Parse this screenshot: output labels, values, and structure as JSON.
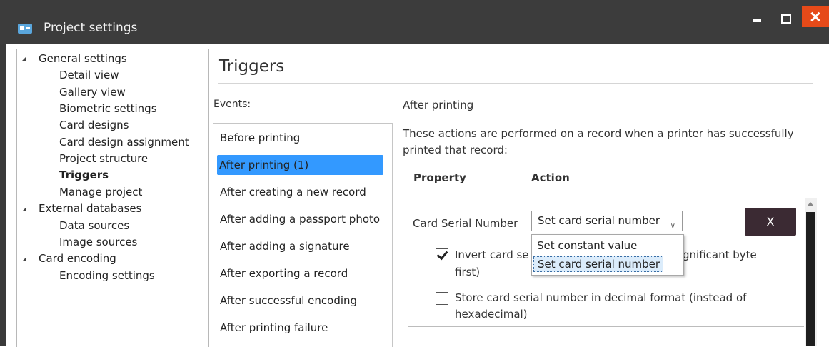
{
  "window": {
    "title": "Project settings"
  },
  "tree": {
    "general": "General settings",
    "detail_view": "Detail view",
    "gallery_view": "Gallery view",
    "biometric": "Biometric settings",
    "card_designs": "Card designs",
    "card_design_assignment": "Card design assignment",
    "project_structure": "Project structure",
    "triggers": "Triggers",
    "manage_project": "Manage project",
    "external_databases": "External databases",
    "data_sources": "Data sources",
    "image_sources": "Image sources",
    "card_encoding": "Card encoding",
    "encoding_settings": "Encoding settings"
  },
  "page": {
    "title": "Triggers"
  },
  "events": {
    "label": "Events:",
    "items": [
      "Before printing",
      "After printing (1)",
      "After creating a new record",
      "After adding a passport photo",
      "After adding a signature",
      "After exporting a record",
      "After successful encoding",
      "After printing failure"
    ],
    "selected_index": 1
  },
  "detail": {
    "heading": "After printing",
    "description": "These actions are performed on a record when a printer has successfully printed that record:",
    "col_property": "Property",
    "col_action": "Action",
    "row_label": "Card Serial Number",
    "select_value": "Set card serial number",
    "remove_label": "X",
    "invert_text_a": "Invert card se",
    "invert_text_b": "gnificant byte",
    "invert_text_c": "first)",
    "invert_checked": true,
    "store_text": "Store card serial number in decimal format (instead of hexadecimal)",
    "store_checked": false
  },
  "dropdown": {
    "options": [
      "Set constant value",
      "Set card serial number"
    ],
    "highlighted_index": 1
  },
  "colors": {
    "selection": "#3399ff",
    "close": "#e64a19",
    "remove_button": "#3b2a33"
  }
}
